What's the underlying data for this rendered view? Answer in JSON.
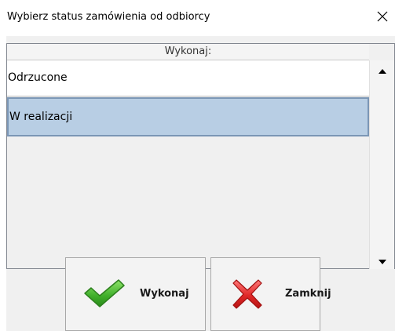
{
  "window": {
    "title": "Wybierz status zamówienia od odbiorcy",
    "close_glyph": "✕",
    "close_icon": "close-icon"
  },
  "list": {
    "header": "Wykonaj:",
    "items": [
      {
        "label": "Odrzucone",
        "selected": false
      },
      {
        "label": "W realizacji",
        "selected": true
      }
    ],
    "selection_color": "#b8cee4"
  },
  "scrollbar": {
    "up_icon": "arrow-up-icon",
    "down_icon": "arrow-down-icon"
  },
  "buttons": {
    "execute": {
      "label": "Wykonaj",
      "icon": "checkmark-icon",
      "color": "#3fae2a"
    },
    "close": {
      "label": "Zamknij",
      "icon": "red-x-icon",
      "color": "#e02828"
    }
  }
}
